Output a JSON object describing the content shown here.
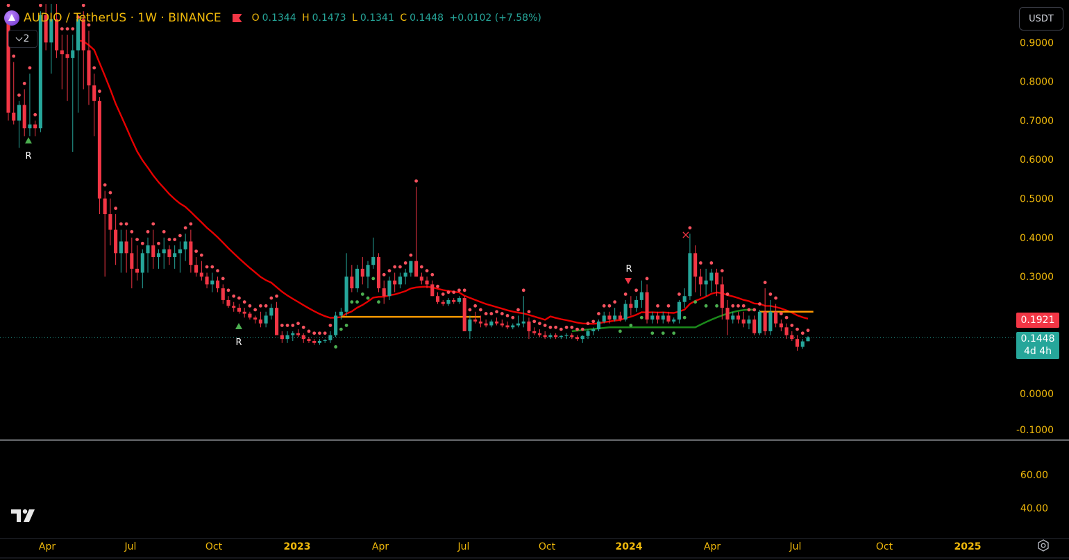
{
  "header": {
    "symbol": "AUDIO / TetherUS · 1W · BINANCE",
    "open_label": "O",
    "open_value": "0.1344",
    "high_label": "H",
    "high_value": "0.1473",
    "low_label": "L",
    "low_value": "0.1341",
    "close_label": "C",
    "close_value": "0.1448",
    "change": "+0.0102 (+7.58%)",
    "indicator_count": "2"
  },
  "currency_button": "USDT",
  "price_tags": {
    "ma_value": "0.1921",
    "last_price": "0.1448",
    "countdown": "4d 4h"
  },
  "colors": {
    "up": "#26a69a",
    "down": "#f23645",
    "ma": "#e60000",
    "support": "#ff9800",
    "trail_green": "#1b8a1b",
    "axis_text": "#f0b90b"
  },
  "icons": [
    "symbol-logo-icon",
    "flag-icon",
    "chevron-down-icon",
    "tradingview-logo-icon",
    "settings-icon"
  ],
  "chart_data": {
    "type": "candlestick",
    "title": "AUDIO / TetherUS · 1W · BINANCE",
    "y_axis_labels": [
      "0.9000",
      "0.8000",
      "0.7000",
      "0.6000",
      "0.5000",
      "0.4000",
      "0.3000",
      "0.0000",
      "-0.1000"
    ],
    "ylim": [
      -0.1,
      0.97
    ],
    "oscillator_axis_labels": [
      "60.00",
      "40.00"
    ],
    "x_axis_labels": [
      "Apr",
      "Jul",
      "Oct",
      "2023",
      "Apr",
      "Jul",
      "Oct",
      "2024",
      "Apr",
      "Jul",
      "Oct",
      "2025"
    ],
    "x_axis_bold": [
      "2023",
      "2024",
      "2025"
    ],
    "signal_markers": [
      "R",
      "R",
      "R",
      "×"
    ],
    "last_close": 0.1448,
    "moving_average_last": 0.1921,
    "candles": [
      [
        0.97,
        0.98,
        0.7,
        0.72
      ],
      [
        0.72,
        0.85,
        0.69,
        0.7
      ],
      [
        0.7,
        0.75,
        0.63,
        0.74
      ],
      [
        0.74,
        0.78,
        0.66,
        0.68
      ],
      [
        0.68,
        0.82,
        0.66,
        0.69
      ],
      [
        0.69,
        0.7,
        0.66,
        0.68
      ],
      [
        0.68,
        0.98,
        0.67,
        0.97
      ],
      [
        0.97,
        1.0,
        0.88,
        0.9
      ],
      [
        0.9,
        1.0,
        0.82,
        0.96
      ],
      [
        0.96,
        1.0,
        0.86,
        0.88
      ],
      [
        0.88,
        0.92,
        0.78,
        0.87
      ],
      [
        0.87,
        0.92,
        0.75,
        0.86
      ],
      [
        0.86,
        0.92,
        0.62,
        0.88
      ],
      [
        0.88,
        0.95,
        0.72,
        0.96
      ],
      [
        0.96,
        0.98,
        0.78,
        0.88
      ],
      [
        0.88,
        0.93,
        0.74,
        0.79
      ],
      [
        0.79,
        0.82,
        0.66,
        0.75
      ],
      [
        0.75,
        0.76,
        0.46,
        0.5
      ],
      [
        0.5,
        0.52,
        0.3,
        0.46
      ],
      [
        0.46,
        0.5,
        0.38,
        0.42
      ],
      [
        0.42,
        0.46,
        0.33,
        0.36
      ],
      [
        0.36,
        0.42,
        0.31,
        0.39
      ],
      [
        0.39,
        0.42,
        0.31,
        0.36
      ],
      [
        0.36,
        0.4,
        0.27,
        0.32
      ],
      [
        0.32,
        0.38,
        0.29,
        0.31
      ],
      [
        0.31,
        0.37,
        0.27,
        0.36
      ],
      [
        0.36,
        0.4,
        0.31,
        0.38
      ],
      [
        0.38,
        0.42,
        0.32,
        0.35
      ],
      [
        0.35,
        0.37,
        0.32,
        0.36
      ],
      [
        0.36,
        0.4,
        0.32,
        0.37
      ],
      [
        0.37,
        0.38,
        0.33,
        0.35
      ],
      [
        0.35,
        0.38,
        0.32,
        0.36
      ],
      [
        0.36,
        0.39,
        0.31,
        0.37
      ],
      [
        0.37,
        0.41,
        0.34,
        0.39
      ],
      [
        0.39,
        0.42,
        0.31,
        0.33
      ],
      [
        0.33,
        0.35,
        0.3,
        0.31
      ],
      [
        0.31,
        0.34,
        0.29,
        0.3
      ],
      [
        0.3,
        0.31,
        0.27,
        0.28
      ],
      [
        0.28,
        0.31,
        0.26,
        0.29
      ],
      [
        0.29,
        0.3,
        0.26,
        0.27
      ],
      [
        0.27,
        0.28,
        0.23,
        0.24
      ],
      [
        0.24,
        0.25,
        0.22,
        0.225
      ],
      [
        0.225,
        0.235,
        0.21,
        0.22
      ],
      [
        0.22,
        0.23,
        0.205,
        0.21
      ],
      [
        0.21,
        0.22,
        0.195,
        0.205
      ],
      [
        0.205,
        0.21,
        0.19,
        0.195
      ],
      [
        0.195,
        0.2,
        0.18,
        0.19
      ],
      [
        0.19,
        0.21,
        0.17,
        0.18
      ],
      [
        0.18,
        0.21,
        0.17,
        0.2
      ],
      [
        0.2,
        0.23,
        0.19,
        0.22
      ],
      [
        0.22,
        0.235,
        0.17,
        0.15
      ],
      [
        0.15,
        0.16,
        0.13,
        0.14
      ],
      [
        0.14,
        0.16,
        0.13,
        0.15
      ],
      [
        0.15,
        0.16,
        0.135,
        0.155
      ],
      [
        0.155,
        0.165,
        0.145,
        0.15
      ],
      [
        0.15,
        0.155,
        0.13,
        0.14
      ],
      [
        0.14,
        0.145,
        0.13,
        0.135
      ],
      [
        0.135,
        0.14,
        0.125,
        0.13
      ],
      [
        0.13,
        0.14,
        0.125,
        0.135
      ],
      [
        0.135,
        0.14,
        0.13,
        0.137
      ],
      [
        0.137,
        0.16,
        0.13,
        0.15
      ],
      [
        0.15,
        0.21,
        0.145,
        0.2
      ],
      [
        0.2,
        0.22,
        0.19,
        0.21
      ],
      [
        0.21,
        0.36,
        0.2,
        0.3
      ],
      [
        0.3,
        0.33,
        0.26,
        0.27
      ],
      [
        0.27,
        0.33,
        0.26,
        0.32
      ],
      [
        0.32,
        0.35,
        0.28,
        0.3
      ],
      [
        0.3,
        0.34,
        0.27,
        0.33
      ],
      [
        0.33,
        0.4,
        0.32,
        0.35
      ],
      [
        0.35,
        0.36,
        0.26,
        0.27
      ],
      [
        0.27,
        0.29,
        0.23,
        0.25
      ],
      [
        0.25,
        0.3,
        0.24,
        0.29
      ],
      [
        0.29,
        0.31,
        0.26,
        0.28
      ],
      [
        0.28,
        0.31,
        0.27,
        0.3
      ],
      [
        0.3,
        0.32,
        0.28,
        0.31
      ],
      [
        0.31,
        0.34,
        0.3,
        0.34
      ],
      [
        0.34,
        0.53,
        0.3,
        0.3
      ],
      [
        0.3,
        0.31,
        0.28,
        0.29
      ],
      [
        0.29,
        0.3,
        0.27,
        0.28
      ],
      [
        0.28,
        0.29,
        0.25,
        0.25
      ],
      [
        0.25,
        0.26,
        0.23,
        0.235
      ],
      [
        0.235,
        0.24,
        0.225,
        0.23
      ],
      [
        0.23,
        0.245,
        0.225,
        0.24
      ],
      [
        0.24,
        0.245,
        0.23,
        0.235
      ],
      [
        0.235,
        0.25,
        0.23,
        0.245
      ],
      [
        0.245,
        0.25,
        0.2,
        0.16
      ],
      [
        0.16,
        0.2,
        0.14,
        0.19
      ],
      [
        0.19,
        0.21,
        0.18,
        0.185
      ],
      [
        0.185,
        0.2,
        0.17,
        0.18
      ],
      [
        0.18,
        0.19,
        0.17,
        0.175
      ],
      [
        0.175,
        0.19,
        0.17,
        0.185
      ],
      [
        0.185,
        0.195,
        0.175,
        0.18
      ],
      [
        0.18,
        0.19,
        0.17,
        0.175
      ],
      [
        0.175,
        0.185,
        0.165,
        0.17
      ],
      [
        0.17,
        0.18,
        0.165,
        0.175
      ],
      [
        0.175,
        0.2,
        0.17,
        0.18
      ],
      [
        0.18,
        0.25,
        0.17,
        0.185
      ],
      [
        0.185,
        0.195,
        0.14,
        0.16
      ],
      [
        0.16,
        0.17,
        0.15,
        0.155
      ],
      [
        0.155,
        0.165,
        0.145,
        0.15
      ],
      [
        0.15,
        0.16,
        0.14,
        0.145
      ],
      [
        0.145,
        0.155,
        0.14,
        0.15
      ],
      [
        0.15,
        0.155,
        0.14,
        0.145
      ],
      [
        0.145,
        0.15,
        0.14,
        0.148
      ],
      [
        0.148,
        0.155,
        0.14,
        0.15
      ],
      [
        0.15,
        0.155,
        0.14,
        0.145
      ],
      [
        0.145,
        0.15,
        0.135,
        0.14
      ],
      [
        0.14,
        0.15,
        0.13,
        0.148
      ],
      [
        0.148,
        0.165,
        0.14,
        0.16
      ],
      [
        0.16,
        0.17,
        0.15,
        0.165
      ],
      [
        0.165,
        0.19,
        0.16,
        0.185
      ],
      [
        0.185,
        0.21,
        0.18,
        0.2
      ],
      [
        0.2,
        0.21,
        0.18,
        0.19
      ],
      [
        0.19,
        0.22,
        0.185,
        0.2
      ],
      [
        0.2,
        0.21,
        0.185,
        0.19
      ],
      [
        0.19,
        0.24,
        0.185,
        0.23
      ],
      [
        0.23,
        0.25,
        0.2,
        0.22
      ],
      [
        0.22,
        0.25,
        0.21,
        0.24
      ],
      [
        0.24,
        0.29,
        0.22,
        0.26
      ],
      [
        0.26,
        0.28,
        0.18,
        0.19
      ],
      [
        0.19,
        0.21,
        0.18,
        0.2
      ],
      [
        0.2,
        0.21,
        0.18,
        0.19
      ],
      [
        0.19,
        0.21,
        0.18,
        0.2
      ],
      [
        0.2,
        0.21,
        0.18,
        0.185
      ],
      [
        0.185,
        0.195,
        0.18,
        0.19
      ],
      [
        0.19,
        0.24,
        0.18,
        0.235
      ],
      [
        0.235,
        0.27,
        0.22,
        0.25
      ],
      [
        0.25,
        0.41,
        0.24,
        0.36
      ],
      [
        0.36,
        0.38,
        0.26,
        0.3
      ],
      [
        0.3,
        0.32,
        0.25,
        0.28
      ],
      [
        0.28,
        0.32,
        0.25,
        0.29
      ],
      [
        0.29,
        0.32,
        0.26,
        0.31
      ],
      [
        0.31,
        0.32,
        0.25,
        0.28
      ],
      [
        0.28,
        0.3,
        0.19,
        0.22
      ],
      [
        0.22,
        0.24,
        0.15,
        0.19
      ],
      [
        0.19,
        0.21,
        0.18,
        0.2
      ],
      [
        0.2,
        0.21,
        0.18,
        0.19
      ],
      [
        0.19,
        0.21,
        0.17,
        0.18
      ],
      [
        0.18,
        0.2,
        0.165,
        0.19
      ],
      [
        0.19,
        0.2,
        0.15,
        0.155
      ],
      [
        0.155,
        0.215,
        0.15,
        0.21
      ],
      [
        0.21,
        0.27,
        0.15,
        0.16
      ],
      [
        0.16,
        0.24,
        0.15,
        0.21
      ],
      [
        0.21,
        0.23,
        0.17,
        0.18
      ],
      [
        0.18,
        0.19,
        0.16,
        0.17
      ],
      [
        0.17,
        0.18,
        0.14,
        0.15
      ],
      [
        0.15,
        0.16,
        0.135,
        0.14
      ],
      [
        0.14,
        0.15,
        0.11,
        0.12
      ],
      [
        0.12,
        0.14,
        0.115,
        0.134
      ],
      [
        0.1344,
        0.1473,
        0.1341,
        0.1448
      ]
    ]
  }
}
